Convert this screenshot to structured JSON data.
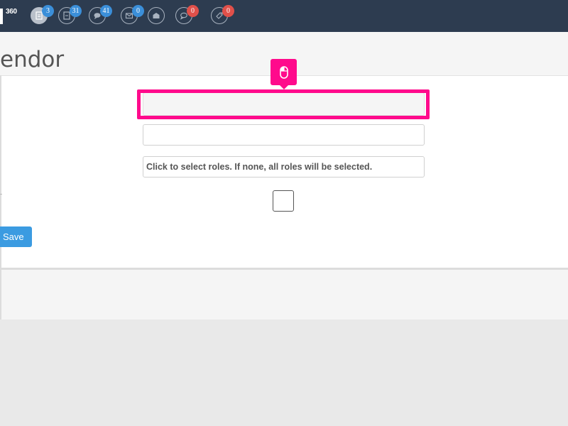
{
  "topbar": {
    "logo_text": "360",
    "icons": [
      {
        "name": "documents-icon",
        "badge": "3",
        "badge_color": "#3b8fd9",
        "active": true
      },
      {
        "name": "report-icon",
        "badge": "31",
        "badge_color": "#3b8fd9",
        "active": false
      },
      {
        "name": "chat-icon",
        "badge": "41",
        "badge_color": "#3b8fd9",
        "active": false
      },
      {
        "name": "mail-icon",
        "badge": "0",
        "badge_color": "#3b8fd9",
        "active": false
      },
      {
        "name": "open-mail-icon",
        "badge": "",
        "badge_color": "",
        "active": false
      },
      {
        "name": "comment-icon",
        "badge": "0",
        "badge_color": "#e0504a",
        "active": false
      },
      {
        "name": "tag-icon",
        "badge": "0",
        "badge_color": "#e0504a",
        "active": false
      }
    ]
  },
  "page": {
    "title": "endor"
  },
  "form": {
    "field1_value": "",
    "field2_value": "",
    "roles_placeholder": "Click to select roles. If none, all roles will be selected.",
    "save_label": "Save"
  },
  "colors": {
    "topbar": "#2d3c50",
    "highlight": "#ff0a8c",
    "primary_button": "#3b9be1",
    "badge_blue": "#3b8fd9",
    "badge_red": "#e0504a"
  }
}
